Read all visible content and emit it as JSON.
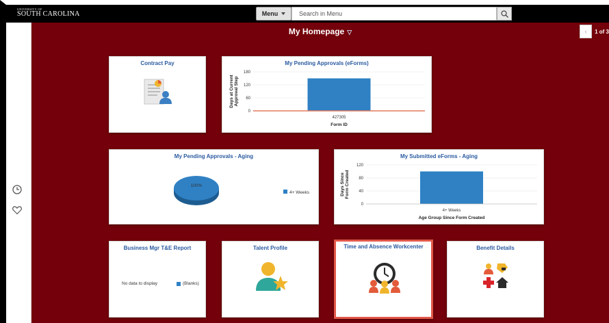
{
  "header": {
    "logo_small": "UNIVERSITY OF",
    "logo_big": "SOUTH CAROLINA",
    "menu_label": "Menu",
    "search_placeholder": "Search in Menu"
  },
  "page": {
    "title": "My Homepage",
    "pager": "1 of 3"
  },
  "tiles": {
    "contract_pay": {
      "title": "Contract Pay"
    },
    "pending_approvals_eforms": {
      "title": "My Pending Approvals (eForms)"
    },
    "pending_approvals_aging": {
      "title": "My Pending Approvals - Aging"
    },
    "submitted_eforms_aging": {
      "title": "My Submitted eForms - Aging"
    },
    "business_mgr": {
      "title": "Business Mgr T&E Report",
      "no_data": "No data to display",
      "legend": "(Blanks)"
    },
    "talent_profile": {
      "title": "Talent Profile"
    },
    "time_absence": {
      "title": "Time and Absence Workcenter"
    },
    "benefit_details": {
      "title": "Benefit Details"
    }
  },
  "chart_data": [
    {
      "type": "bar",
      "title": "My Pending Approvals (eForms)",
      "categories": [
        "427305"
      ],
      "values": [
        150
      ],
      "xlabel": "Form ID",
      "ylabel": "Days at Current Approval Step",
      "yticks": [
        0,
        60,
        120,
        180
      ],
      "ylim": [
        0,
        180
      ],
      "color": "#2f81c4"
    },
    {
      "type": "pie",
      "title": "My Pending Approvals - Aging",
      "slices": [
        {
          "label": "4+ Weeks",
          "value": 100,
          "display": "100%"
        }
      ],
      "legend": "right",
      "color": "#2f81c4"
    },
    {
      "type": "bar",
      "title": "My Submitted eForms - Aging",
      "categories": [
        "4+ Weeks"
      ],
      "values": [
        100
      ],
      "xlabel": "Age Group Since Form Created",
      "ylabel": "Days Since Form Created",
      "yticks": [
        0,
        40,
        80,
        120
      ],
      "ylim": [
        0,
        120
      ],
      "color": "#2f81c4"
    }
  ],
  "colors": {
    "garnet": "#73000a",
    "tile_title": "#2a5aa0",
    "bar": "#2f81c4",
    "selected_border": "#e2584a"
  }
}
